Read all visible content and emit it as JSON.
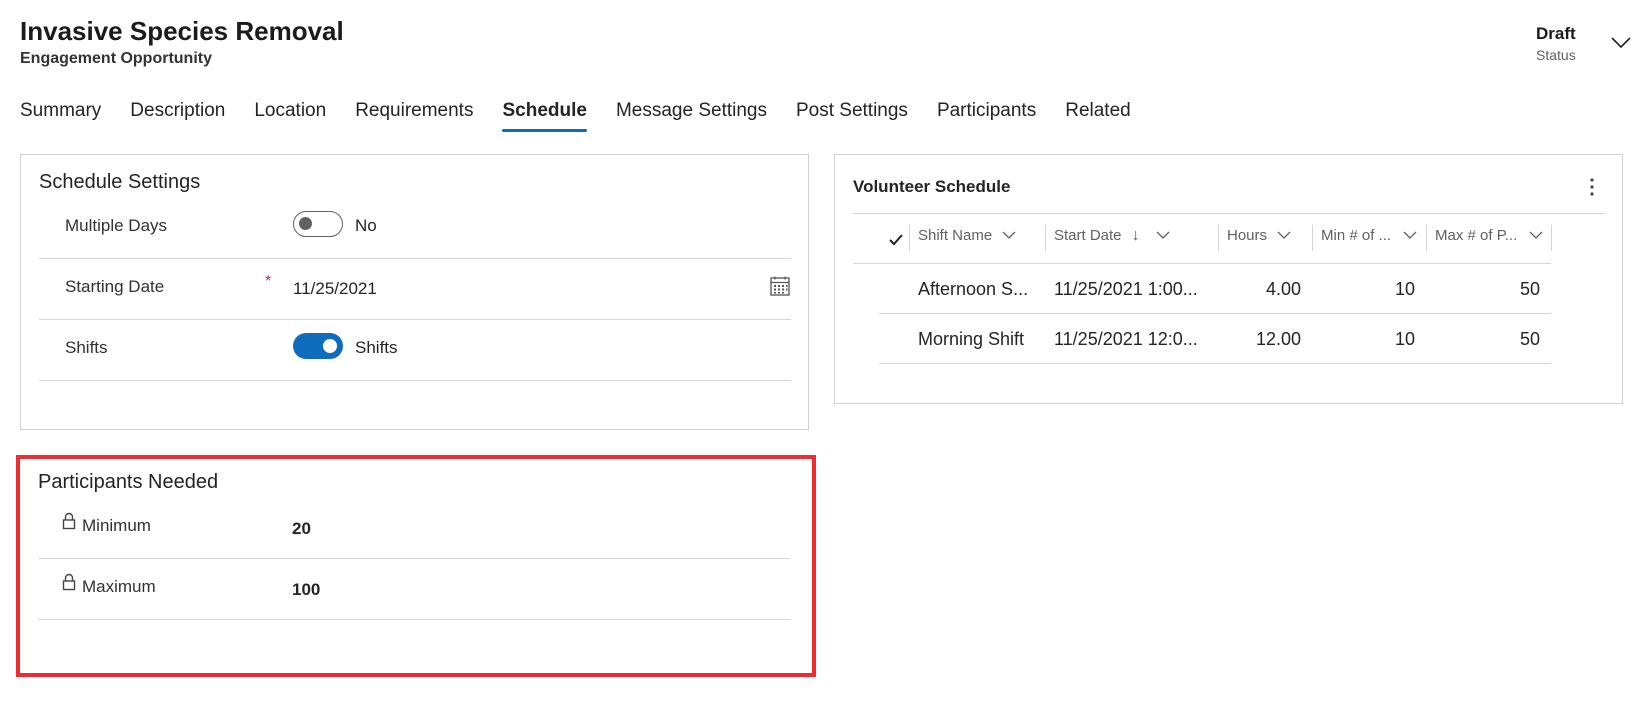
{
  "header": {
    "title": "Invasive Species Removal",
    "subtitle": "Engagement Opportunity",
    "status_value": "Draft",
    "status_label": "Status"
  },
  "tabs": [
    {
      "label": "Summary",
      "active": false
    },
    {
      "label": "Description",
      "active": false
    },
    {
      "label": "Location",
      "active": false
    },
    {
      "label": "Requirements",
      "active": false
    },
    {
      "label": "Schedule",
      "active": true
    },
    {
      "label": "Message Settings",
      "active": false
    },
    {
      "label": "Post Settings",
      "active": false
    },
    {
      "label": "Participants",
      "active": false
    },
    {
      "label": "Related",
      "active": false
    }
  ],
  "schedule_settings": {
    "title": "Schedule Settings",
    "multiple_days": {
      "label": "Multiple Days",
      "toggle_on": false,
      "value": "No"
    },
    "starting_date": {
      "label": "Starting Date",
      "required_marker": "*",
      "value": "11/25/2021"
    },
    "shifts": {
      "label": "Shifts",
      "toggle_on": true,
      "value": "Shifts"
    }
  },
  "participants_needed": {
    "title": "Participants Needed",
    "minimum": {
      "label": "Minimum",
      "value": "20"
    },
    "maximum": {
      "label": "Maximum",
      "value": "100"
    }
  },
  "volunteer_schedule": {
    "title": "Volunteer Schedule",
    "columns": [
      "Shift Name",
      "Start Date",
      "Hours",
      "Min # of ...",
      "Max # of P..."
    ],
    "sort_indicator": "↓",
    "rows": [
      {
        "shift_name": "Afternoon S...",
        "start_date": "11/25/2021 1:00...",
        "hours": "4.00",
        "min": "10",
        "max": "50"
      },
      {
        "shift_name": "Morning Shift",
        "start_date": "11/25/2021 12:0...",
        "hours": "12.00",
        "min": "10",
        "max": "50"
      }
    ]
  },
  "colors": {
    "accent": "#0f6cbd",
    "required": "#c4314b",
    "highlight": "#ee2b30"
  }
}
